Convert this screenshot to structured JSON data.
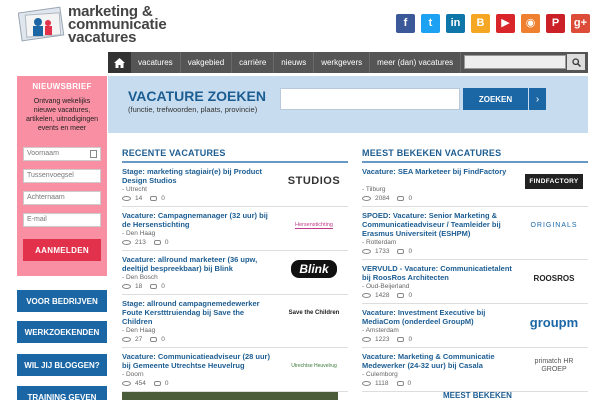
{
  "header": {
    "logo_lines": [
      "marketing &",
      "communicatie",
      "vacatures"
    ],
    "socials": [
      {
        "name": "facebook-icon",
        "glyph": "f",
        "color": "#3b5998"
      },
      {
        "name": "twitter-icon",
        "glyph": "t",
        "color": "#1da1f2"
      },
      {
        "name": "linkedin-icon",
        "glyph": "in",
        "color": "#0e76a8"
      },
      {
        "name": "blogger-icon",
        "glyph": "B",
        "color": "#f5a623"
      },
      {
        "name": "youtube-icon",
        "glyph": "▶",
        "color": "#d9252a"
      },
      {
        "name": "rss-icon",
        "glyph": "◉",
        "color": "#ee802f"
      },
      {
        "name": "pinterest-icon",
        "glyph": "P",
        "color": "#cb2027"
      },
      {
        "name": "googleplus-icon",
        "glyph": "g+",
        "color": "#dd4b39"
      }
    ]
  },
  "nav": {
    "items": [
      "vacatures",
      "vakgebied",
      "carrière",
      "nieuws",
      "werkgevers",
      "meer (dan) vacatures"
    ]
  },
  "newsletter": {
    "title": "NIEUWSBRIEF",
    "description": "Ontvang wekelijks nieuwe vacatures, artikelen, uitnodigingen events en meer",
    "fields": [
      {
        "placeholder": "Voornaam"
      },
      {
        "placeholder": "Tussenvoegsel"
      },
      {
        "placeholder": "Achternaam"
      },
      {
        "placeholder": "E-mail"
      }
    ],
    "button": "AANMELDEN"
  },
  "side_buttons": [
    "VOOR BEDRIJVEN",
    "WERKZOEKENDEN",
    "WIL JIJ BLOGGEN?",
    "TRAINING GEVEN"
  ],
  "search": {
    "title": "VACATURE ZOEKEN",
    "subtitle": "(functie, trefwoorden, plaats, provincie)",
    "button": "ZOEKEN",
    "arrow": "›"
  },
  "recent": {
    "title": "RECENTE VACATURES",
    "jobs": [
      {
        "title": "Stage: marketing stagiair(e) bij Product Design Studios",
        "location": "- Utrecht",
        "views": "14",
        "comments": "0",
        "logo": "STUDIOS"
      },
      {
        "title": "Vacature: Campagnemanager (32 uur) bij de Hersenstichting",
        "location": "- Den Haag",
        "views": "213",
        "comments": "0",
        "logo": "Hersenstichting"
      },
      {
        "title": "Vacature: allround marketeer (36 upw, deeltijd bespreekbaar) bij Blink",
        "location": "- Den Bosch",
        "views": "18",
        "comments": "0",
        "logo": "Blink"
      },
      {
        "title": "Stage: allround campagnemedewerker Foute Kerstttruiendag bij Save the Children",
        "location": "- Den Haag",
        "views": "27",
        "comments": "0",
        "logo": "Save the Children"
      },
      {
        "title": "Vacature: Communicatieadviseur (28 uur) bij Gemeente Utrechtse Heuvelrug",
        "location": "- Doorn",
        "views": "454",
        "comments": "0",
        "logo": "Utrechtse Heuvelrug"
      }
    ]
  },
  "popular": {
    "title": "MEEST BEKEKEN VACATURES",
    "jobs": [
      {
        "title": "Vacature: SEA Marketeer bij FindFactory",
        "location": "- Tilburg",
        "views": "2084",
        "comments": "0",
        "logo": "FINDFACTORY"
      },
      {
        "title": "SPOED: Vacature: Senior Marketing & Communicatieadviseur / Teamleider bij Erasmus Universiteit (ESHPM)",
        "location": "- Rotterdam",
        "views": "1733",
        "comments": "0",
        "logo": "ORIGINALS"
      },
      {
        "title": "VERVULD - Vacature: Communicatietalent bij RoosRos Architecten",
        "location": "- Oud-Beijerland",
        "views": "1428",
        "comments": "0",
        "logo": "ROOSROS"
      },
      {
        "title": "Vacature: Investment Executive bij MediaCom (onderdeel GroupM)",
        "location": "- Amsterdam",
        "views": "1223",
        "comments": "0",
        "logo": "groupm"
      },
      {
        "title": "Vacature: Marketing & Communicatie Medewerker (24-32 uur) bij Casala",
        "location": "- Culemborg",
        "views": "1118",
        "comments": "0",
        "logo": "primatch HR GROEP"
      }
    ]
  },
  "more": {
    "title": "MEEST BEKEKEN"
  }
}
